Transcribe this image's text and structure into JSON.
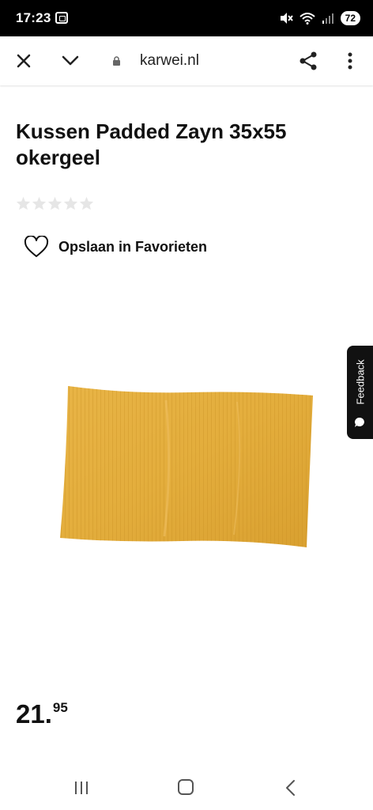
{
  "status_bar": {
    "time": "17:23",
    "battery": "72"
  },
  "browser": {
    "url": "karwei.nl"
  },
  "product": {
    "title": "Kussen Padded Zayn 35x55 okergeel",
    "rating": {
      "stars": 0,
      "max": 5
    },
    "favorite_label": "Opslaan in Favorieten",
    "price_main": "21.",
    "price_decimals": "95",
    "image_color": "#e3ad3c"
  },
  "feedback": {
    "label": "Feedback"
  }
}
